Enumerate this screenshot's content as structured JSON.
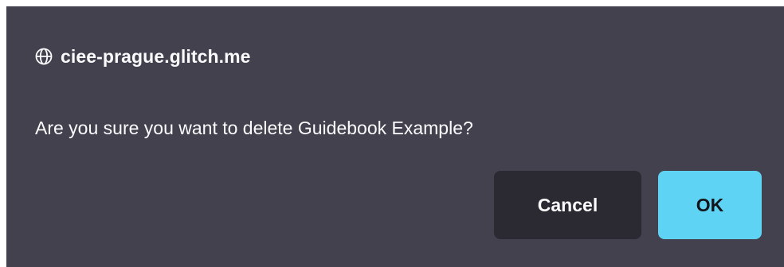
{
  "dialog": {
    "origin": "ciee-prague.glitch.me",
    "origin_icon": "globe-icon",
    "message": "Are you sure you want to delete Guidebook Example?",
    "cancel_label": "Cancel",
    "ok_label": "OK"
  },
  "colors": {
    "background": "#42414d",
    "text": "#fbfbfe",
    "cancel_button": "#2b2a33",
    "ok_button": "#5fd3f3",
    "ok_text": "#15141a"
  }
}
